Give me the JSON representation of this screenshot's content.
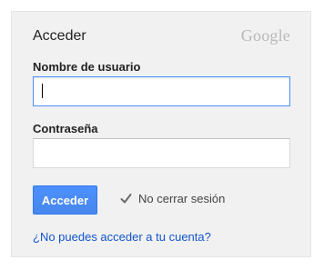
{
  "login": {
    "title": "Acceder",
    "logo_text": "Google",
    "username_label": "Nombre de usuario",
    "username_value": "",
    "password_label": "Contraseña",
    "password_value": "",
    "submit_label": "Acceder",
    "remember_checked": true,
    "remember_label": "No cerrar sesión",
    "help_link": "¿No puedes acceder a tu cuenta?"
  },
  "colors": {
    "card_background": "#f1f1f1",
    "button_blue": "#4d90fe",
    "link_blue": "#1155cc",
    "focus_border": "#4d90fe"
  },
  "icons": {
    "remember_check": "checkmark-icon"
  }
}
